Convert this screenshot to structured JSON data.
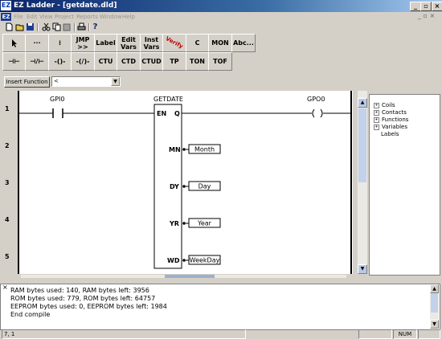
{
  "window": {
    "title": "EZ Ladder - [getdate.dld]",
    "app_icon": "EZ"
  },
  "menu": {
    "app_icon": "EZ",
    "items": [
      "File",
      "Edit",
      "View",
      "Project",
      "Reports",
      "Window",
      "Help"
    ]
  },
  "toolbar_icons": [
    "new-file-icon",
    "open-folder-icon",
    "save-disk-icon",
    "cut-icon",
    "copy-icon",
    "paste-icon",
    "print-icon",
    "help-icon"
  ],
  "palette": {
    "row1": [
      "JMP\n>>",
      "Label",
      "Edit\nVars",
      "Inst\nVars",
      "C",
      "MON",
      "Abc..."
    ],
    "row2": [
      "CTU",
      "CTD",
      "CTUD",
      "TP",
      "TON",
      "TOF"
    ],
    "verify_label": "Verify",
    "insert_function": "Insert Function",
    "function_combo": "<"
  },
  "ladder": {
    "rung_numbers": [
      "1",
      "2",
      "3",
      "4",
      "5"
    ],
    "contact_label": "GPI0",
    "coil_label": "GPO0",
    "block": {
      "name": "GETDATE",
      "en": "EN",
      "q": "Q",
      "pins": [
        "MN",
        "DY",
        "YR",
        "WD"
      ]
    },
    "outputs": [
      "Month",
      "Day",
      "Year",
      "WeekDay"
    ]
  },
  "tree": [
    "Coils",
    "Contacts",
    "Functions",
    "Variables",
    "Labels"
  ],
  "output_lines": [
    "RAM bytes used: 140, RAM bytes left: 3956",
    "ROM bytes used: 779, ROM bytes left: 64757",
    "EEPROM bytes used: 0, EEPROM bytes left: 1984",
    "End compile"
  ],
  "status": {
    "position": "7, 1",
    "num": "NUM"
  }
}
